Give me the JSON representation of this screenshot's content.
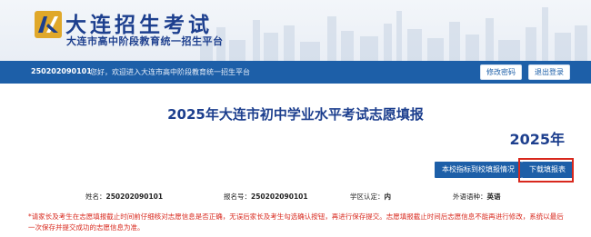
{
  "header": {
    "title": "大连招生考试",
    "subtitle": "大连市高中阶段教育统一招生平台",
    "logo_icon": "dalian-exam-logo"
  },
  "infobar": {
    "user_id": "250202090101",
    "welcome": "您好，欢迎进入大连市高中阶段教育统一招生平台",
    "change_password": "修改密码",
    "logout": "退出登录"
  },
  "main": {
    "heading": "2025年大连市初中学业水平考试志愿填报",
    "year": "2025年",
    "btn_status": "本校指标到校填报情况",
    "btn_download": "下载填报表"
  },
  "student": {
    "name_label": "姓名：",
    "name_value": "250202090101",
    "exam_no_label": "报名号：",
    "exam_no_value": "250202090101",
    "district_label": "学区认定：",
    "district_value": "内",
    "lang_label": "外语语种：",
    "lang_value": "英语"
  },
  "notice": "*请家长及考生在志愿填报截止时间前仔细核对志愿信息是否正确，无误后家长及考生勾选确认按钮，再进行保存提交。志愿填报截止时间后志愿信息不能再进行修改，系统以最后一次保存并提交成功的志愿信息为准。",
  "colors": {
    "brand_blue": "#1d5fa8",
    "title_blue": "#1d3f8e",
    "alert_red": "#d8281d"
  }
}
